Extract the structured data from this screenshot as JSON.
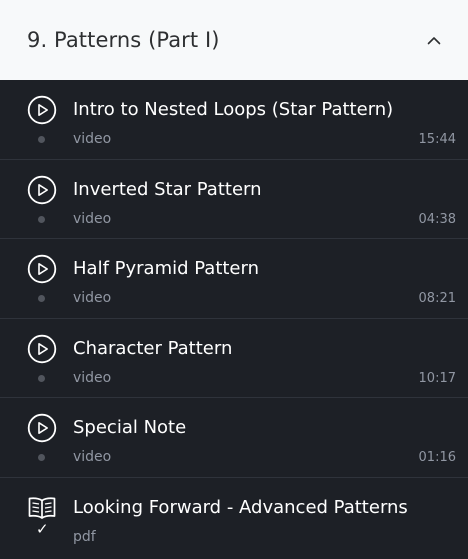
{
  "section": {
    "title": "9. Patterns (Part I)",
    "toggle_icon": "chevron-up-icon"
  },
  "lectures": [
    {
      "title": "Intro to Nested Loops (Star Pattern)",
      "kind": "video",
      "duration": "15:44",
      "icon": "play-circle-icon",
      "completed": false
    },
    {
      "title": "Inverted Star Pattern",
      "kind": "video",
      "duration": "04:38",
      "icon": "play-circle-icon",
      "completed": false
    },
    {
      "title": "Half Pyramid Pattern",
      "kind": "video",
      "duration": "08:21",
      "icon": "play-circle-icon",
      "completed": false
    },
    {
      "title": "Character Pattern",
      "kind": "video",
      "duration": "10:17",
      "icon": "play-circle-icon",
      "completed": false
    },
    {
      "title": "Special Note",
      "kind": "video",
      "duration": "01:16",
      "icon": "play-circle-icon",
      "completed": false
    },
    {
      "title": "Looking Forward - Advanced Patterns",
      "kind": "pdf",
      "duration": "",
      "icon": "book-icon",
      "completed": true
    }
  ],
  "colors": {
    "header_bg": "#f7f9fa",
    "list_bg": "#1d2026",
    "title_text": "#ffffff",
    "meta_text": "#9197a3"
  }
}
